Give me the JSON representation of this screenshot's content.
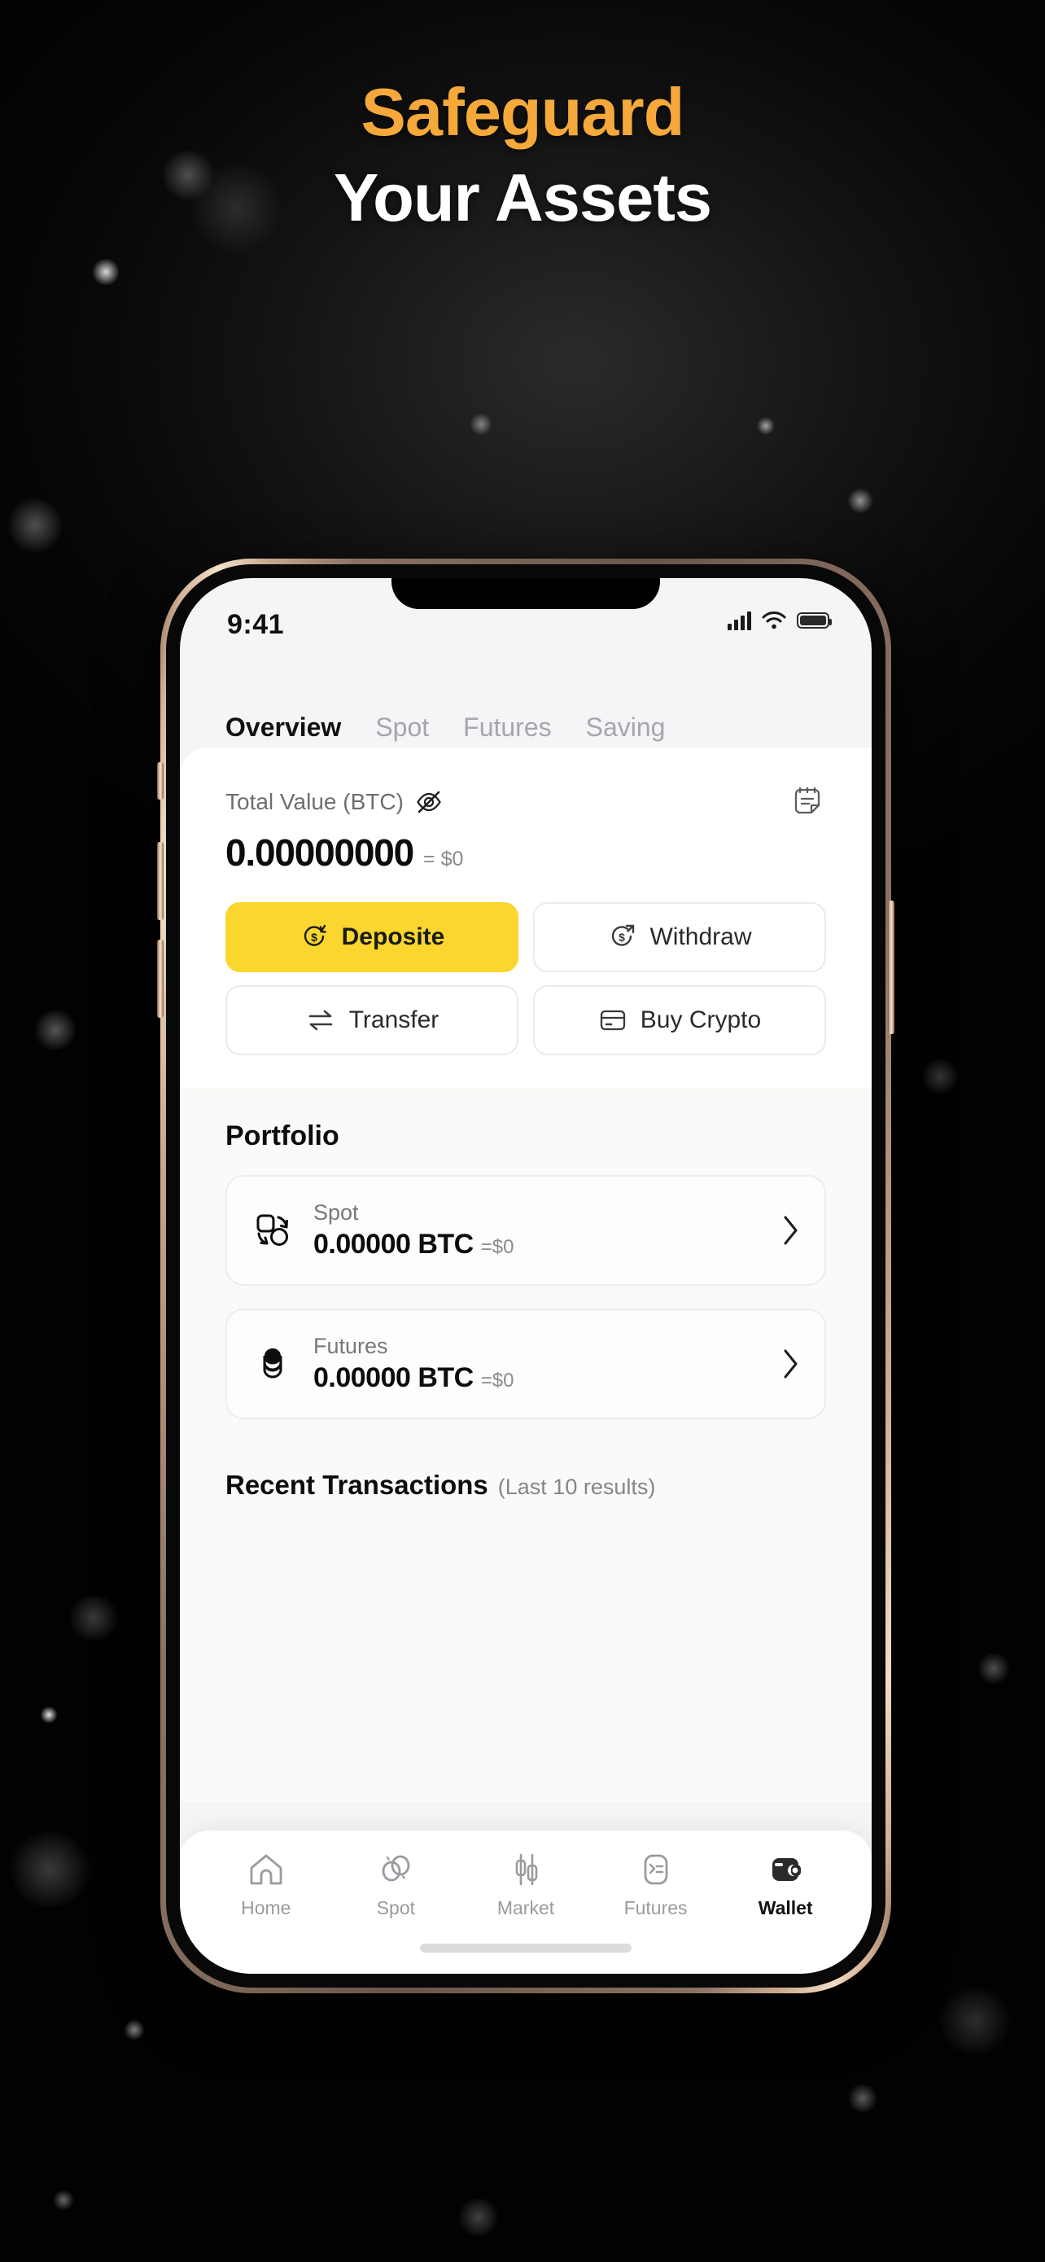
{
  "hero": {
    "line1": "Safeguard",
    "line2": "Your Assets",
    "accent_color": "#F4A93A",
    "line2_color": "#FFFFFF",
    "background_color": "#050505"
  },
  "phone": {
    "frame_color": "#D8B79A",
    "screen_bg": "#F5F5F7"
  },
  "status_bar": {
    "time": "9:41",
    "icons": [
      "cellular-signal-icon",
      "wifi-icon",
      "battery-icon"
    ]
  },
  "tabs": [
    {
      "label": "Overview",
      "active": true
    },
    {
      "label": "Spot",
      "active": false
    },
    {
      "label": "Futures",
      "active": false
    },
    {
      "label": "Saving",
      "active": false
    }
  ],
  "balance": {
    "label": "Total Value (BTC)",
    "hide_icon": "eye-off-icon",
    "record_icon": "note-record-icon",
    "amount": "0.00000000",
    "usd": "= $0"
  },
  "actions": [
    {
      "label": "Deposite",
      "icon": "deposit-icon",
      "primary": true
    },
    {
      "label": "Withdraw",
      "icon": "withdraw-icon",
      "primary": false
    },
    {
      "label": "Transfer",
      "icon": "transfer-icon",
      "primary": false
    },
    {
      "label": "Buy Crypto",
      "icon": "card-icon",
      "primary": false
    }
  ],
  "portfolio": {
    "title": "Portfolio",
    "rows": [
      {
        "name": "Spot",
        "value": "0.00000 BTC",
        "usd": "=$0",
        "icon": "spot-icon"
      },
      {
        "name": "Futures",
        "value": "0.00000 BTC",
        "usd": "=$0",
        "icon": "futures-coins-icon"
      }
    ]
  },
  "recent": {
    "title": "Recent Transactions",
    "subtitle": "(Last 10 results)"
  },
  "bottom_nav": [
    {
      "label": "Home",
      "icon": "home-icon",
      "active": false
    },
    {
      "label": "Spot",
      "icon": "spot-icon",
      "active": false
    },
    {
      "label": "Market",
      "icon": "market-candles-icon",
      "active": false
    },
    {
      "label": "Futures",
      "icon": "futures-list-icon",
      "active": false
    },
    {
      "label": "Wallet",
      "icon": "wallet-icon",
      "active": true
    }
  ],
  "colors": {
    "accent_yellow": "#FAD62E",
    "hero_orange": "#F4A93A"
  }
}
